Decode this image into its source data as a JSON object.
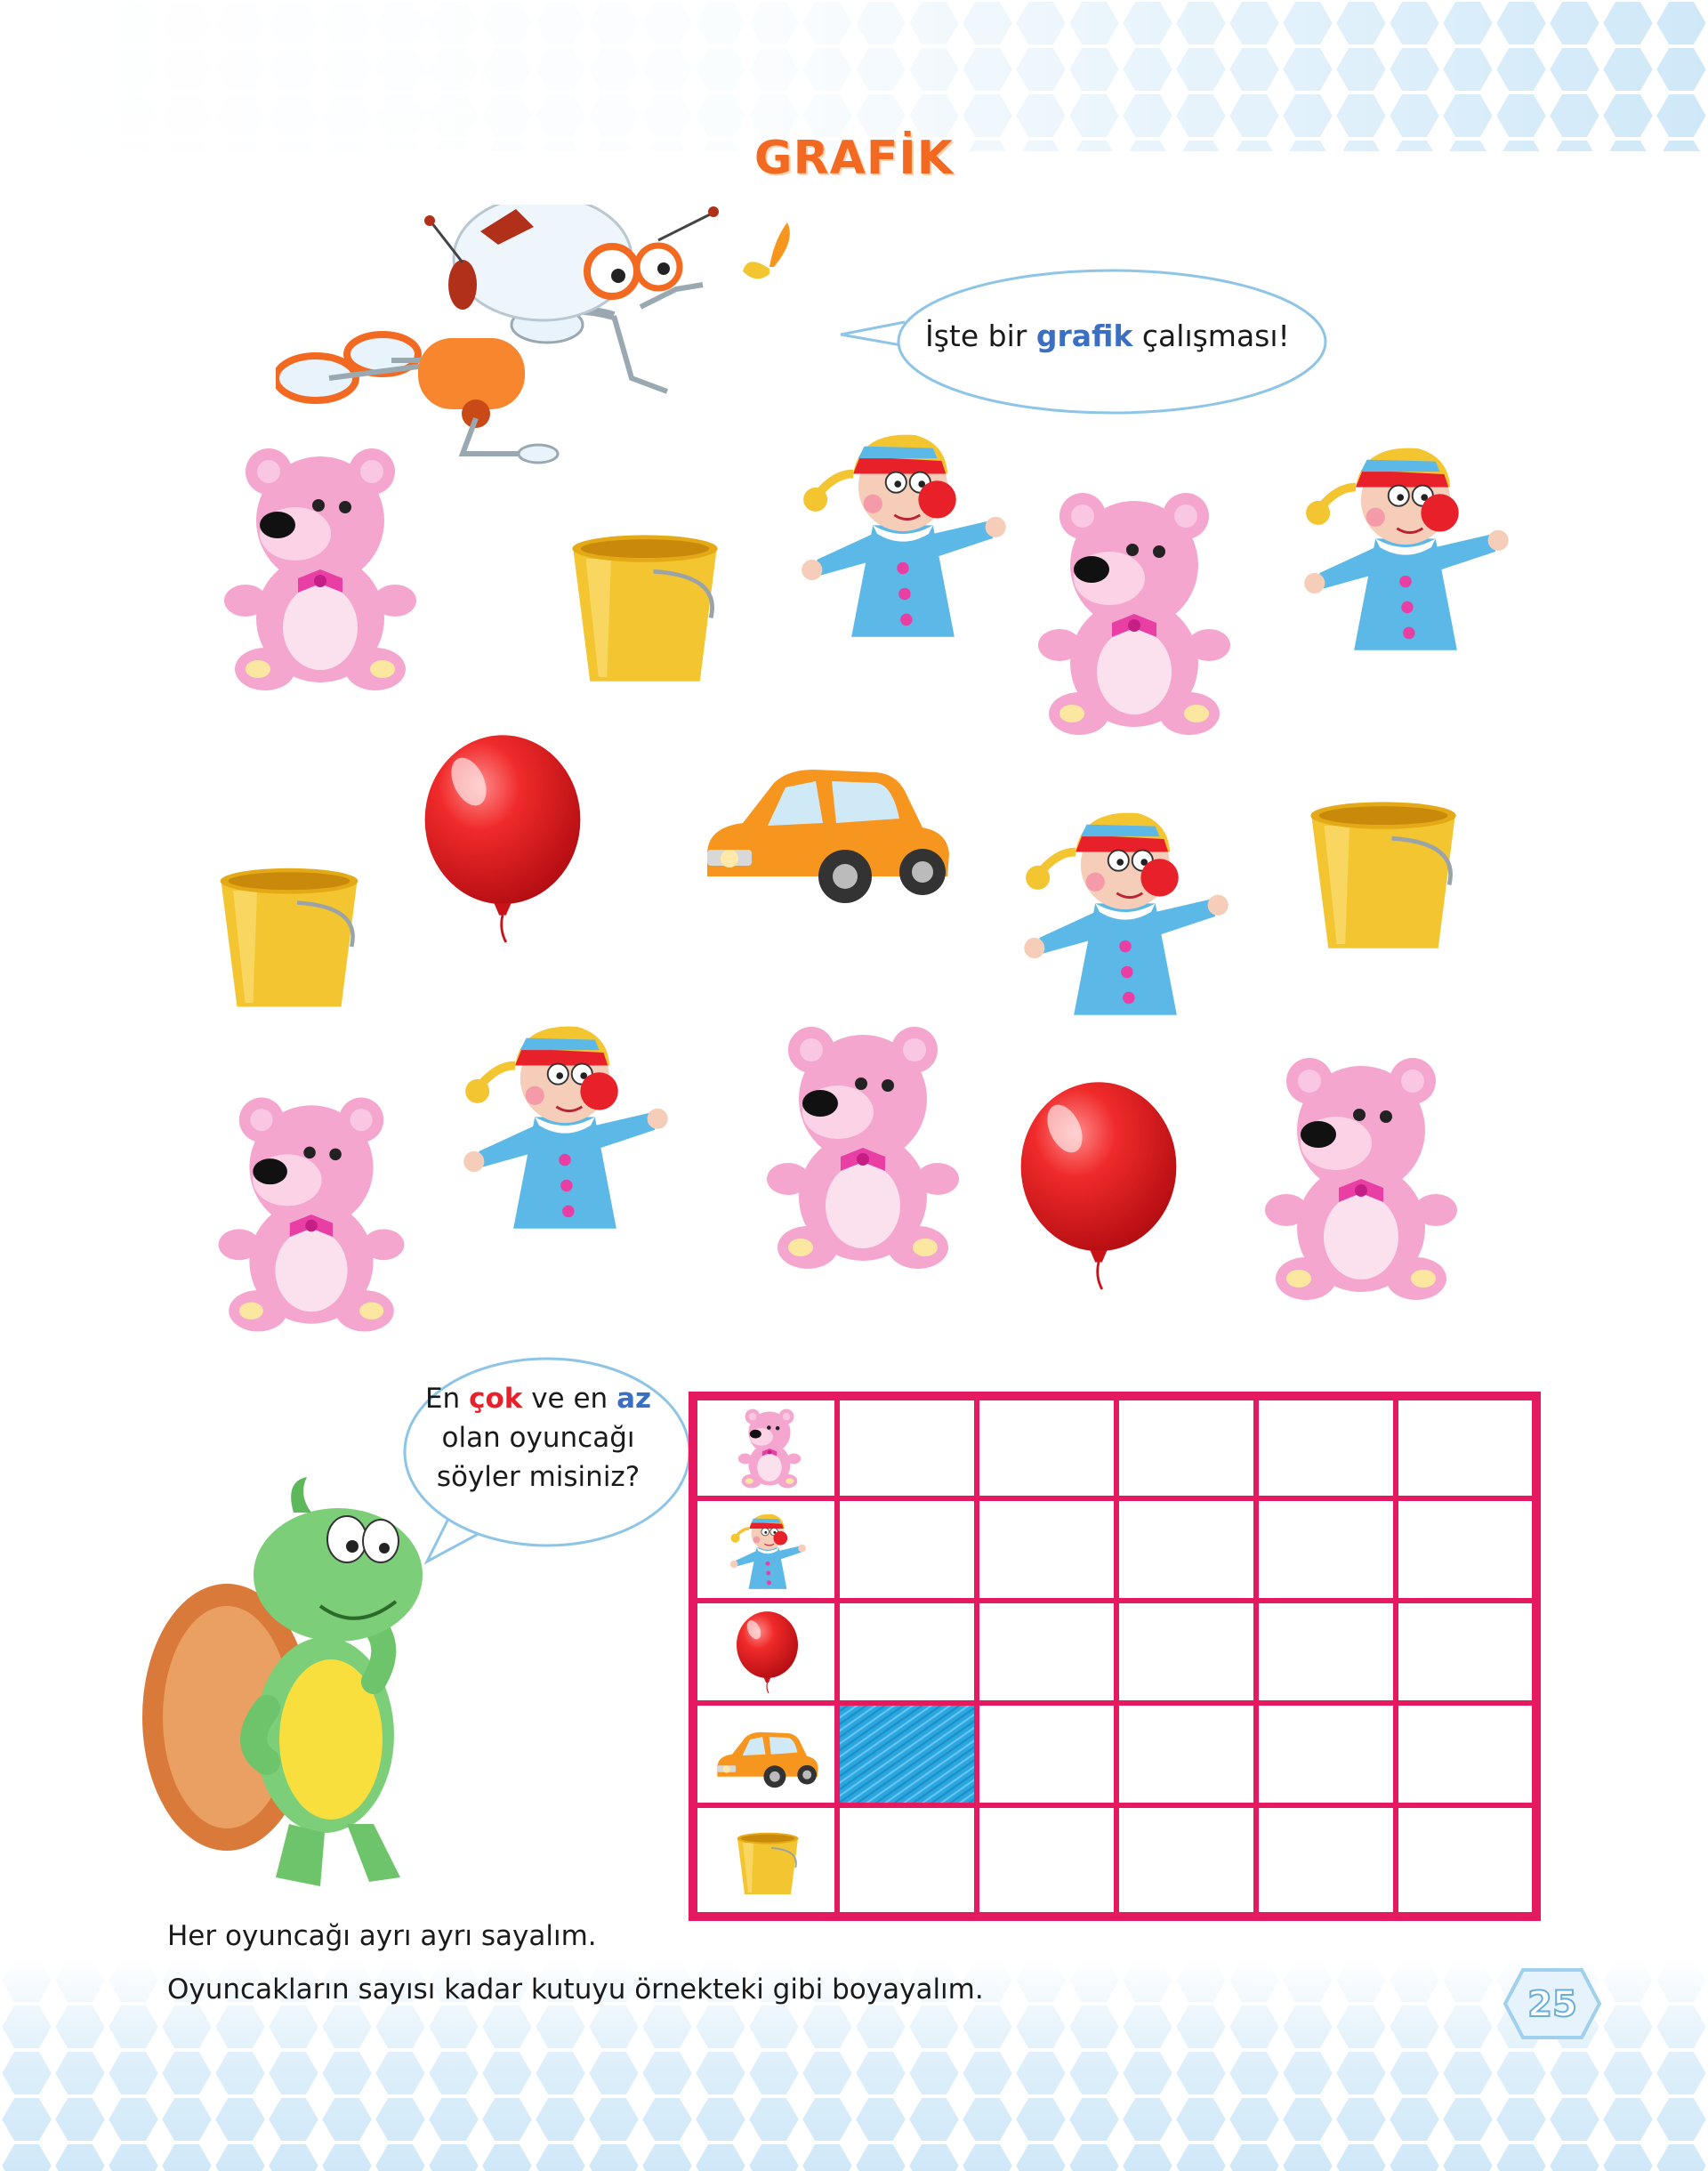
{
  "page": {
    "title": "GRAFİK",
    "page_number": "25"
  },
  "robot_bubble": {
    "before": "İşte bir ",
    "highlight": "grafik",
    "after": " çalışması!"
  },
  "turtle_bubble": {
    "line1_a": "En ",
    "line1_b": "çok",
    "line1_c": " ve en ",
    "line1_d": "az",
    "line2": "olan oyuncağı",
    "line3": "söyler misiniz?"
  },
  "instructions": {
    "line1": "Her oyuncağı ayrı ayrı sayalım.",
    "line2": "Oyuncakların sayısı kadar kutuyu örnekteki gibi boyayalım."
  },
  "grid": {
    "rows": [
      "teddy-bear",
      "clown",
      "balloon",
      "car",
      "bucket"
    ],
    "columns": 5,
    "example_filled": {
      "row": "car",
      "count": 1
    },
    "line_color": "#e5195f",
    "fill_color": "#2aa7e0"
  },
  "colors": {
    "title": "#f26a21",
    "bear": "#f4a6cf",
    "clown_body": "#5cb8e6",
    "balloon": "#e8202a",
    "car": "#f7961e",
    "bucket": "#f3c531",
    "hex": "#d9eefb"
  }
}
